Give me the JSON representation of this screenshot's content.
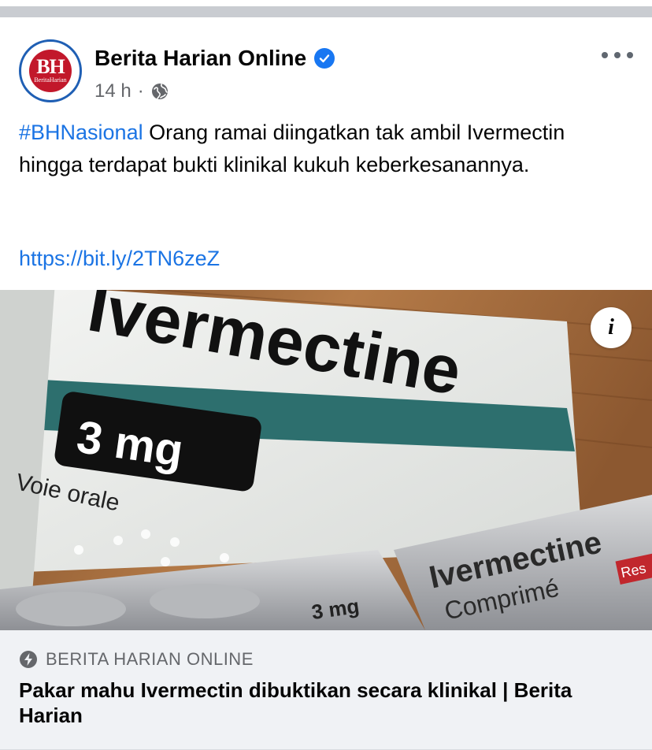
{
  "post": {
    "page_name": "Berita Harian Online",
    "avatar_text": "BH",
    "avatar_subtext": "BeritaHarian",
    "time": "14 h",
    "separator": "·",
    "hashtag": "#BHNasional",
    "body_text": " Orang ramai diingatkan tak ambil Ivermectin hingga terdapat bukti klinikal kukuh keberkesanannya.",
    "link_text": "https://bit.ly/2TN6zeZ"
  },
  "image": {
    "box_brand": "Ivermectine",
    "box_dose": "3 mg",
    "box_route": "Voie orale",
    "blister_brand": "Ivermectine",
    "blister_sub": "Comprimé",
    "blister_dose": "3 mg",
    "blister_tag": "Res",
    "info_label": "i"
  },
  "link_card": {
    "source": "BERITA HARIAN ONLINE",
    "title": "Pakar mahu Ivermectin dibuktikan secara klinikal | Berita Harian"
  },
  "colors": {
    "link_blue": "#1b74e4",
    "verified_blue": "#1877f2",
    "meta_gray": "#65676b",
    "brand_red": "#c2182b"
  },
  "icons": {
    "verified": "verified-badge-icon",
    "globe": "globe-icon",
    "more": "more-options-icon",
    "info": "info-icon",
    "bolt": "lightning-bolt-icon"
  }
}
